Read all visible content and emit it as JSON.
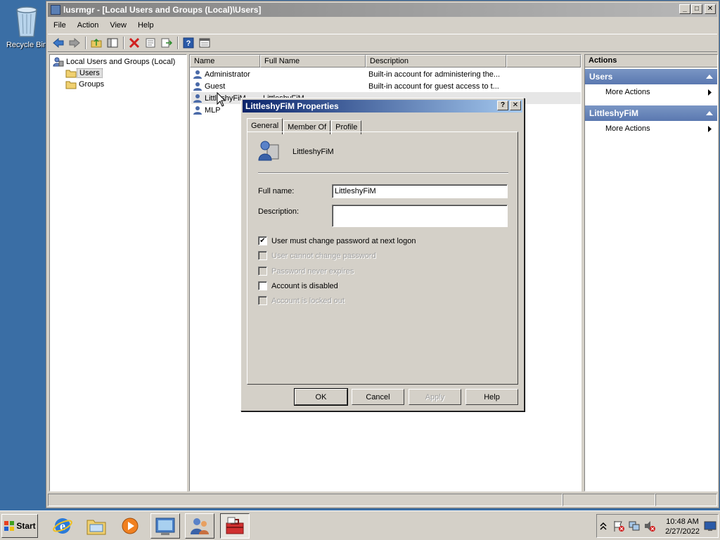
{
  "desktop": {
    "recycle_bin_label": "Recycle Bin"
  },
  "window": {
    "title": "lusrmgr - [Local Users and Groups (Local)\\Users]",
    "menu": [
      "File",
      "Action",
      "View",
      "Help"
    ]
  },
  "tree": {
    "root": "Local Users and Groups (Local)",
    "children": [
      "Users",
      "Groups"
    ]
  },
  "list": {
    "columns": [
      "Name",
      "Full Name",
      "Description"
    ],
    "rows": [
      {
        "name": "Administrator",
        "full_name": "",
        "description": "Built-in account for administering the..."
      },
      {
        "name": "Guest",
        "full_name": "",
        "description": "Built-in account for guest access to t..."
      },
      {
        "name": "LittleshyFiM",
        "full_name": "LittleshyFiM",
        "description": ""
      },
      {
        "name": "MLP",
        "full_name": "",
        "description": ""
      }
    ]
  },
  "actions": {
    "header": "Actions",
    "sections": [
      {
        "title": "Users",
        "items": [
          "More Actions"
        ]
      },
      {
        "title": "LittleshyFiM",
        "items": [
          "More Actions"
        ]
      }
    ]
  },
  "dialog": {
    "title": "LittleshyFiM Properties",
    "tabs": [
      "General",
      "Member Of",
      "Profile"
    ],
    "user_name": "LittleshyFiM",
    "full_name_label": "Full name:",
    "full_name_value": "LittleshyFiM",
    "description_label": "Description:",
    "description_value": "",
    "checkboxes": [
      {
        "label": "User must change password at next logon",
        "checked": true,
        "enabled": true
      },
      {
        "label": "User cannot change password",
        "checked": false,
        "enabled": false
      },
      {
        "label": "Password never expires",
        "checked": false,
        "enabled": false
      },
      {
        "label": "Account is disabled",
        "checked": false,
        "enabled": true
      },
      {
        "label": "Account is locked out",
        "checked": false,
        "enabled": false
      }
    ],
    "buttons": {
      "ok": "OK",
      "cancel": "Cancel",
      "apply": "Apply",
      "help": "Help"
    }
  },
  "taskbar": {
    "start_label": "Start",
    "time": "10:48 AM",
    "date": "2/27/2022"
  },
  "colors": {
    "desktop": "#3a6ea5",
    "dialog_title": "#0a246a",
    "action_section": "#5a78b0"
  }
}
